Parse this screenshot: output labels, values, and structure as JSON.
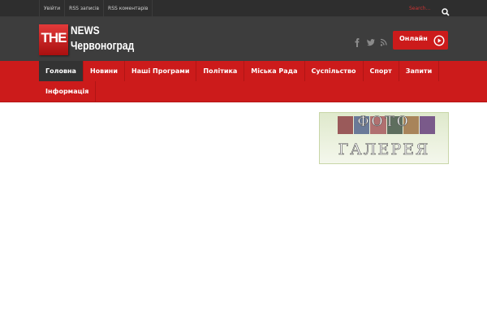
{
  "topbar": {
    "links": [
      "Увійти",
      "RSS записів",
      "RSS коментарів"
    ],
    "search_placeholder": "Search..."
  },
  "logo": {
    "the": "THE",
    "news": "NEWS",
    "city": "Червоноград"
  },
  "header": {
    "social_icons": [
      "facebook-icon",
      "twitter-icon",
      "rss-icon"
    ],
    "online_label": "Онлайн"
  },
  "nav": {
    "items": [
      {
        "label": "Головна",
        "active": true
      },
      {
        "label": "Новини",
        "active": false
      },
      {
        "label": "Наші Програми",
        "active": false
      },
      {
        "label": "Політика",
        "active": false
      },
      {
        "label": "Міська Рада",
        "active": false
      },
      {
        "label": "Суспільство",
        "active": false
      },
      {
        "label": "Спорт",
        "active": false
      },
      {
        "label": "Запити",
        "active": false
      },
      {
        "label": "Інформація",
        "active": false
      }
    ]
  },
  "sidebar": {
    "gallery_line1": "ФОТО",
    "gallery_line2": "ГАЛЕРЕЯ"
  },
  "colors": {
    "topbar_bg": "#2e2e2e",
    "header_bg": "#3d3d3d",
    "accent_red": "#cc1b1b",
    "nav_active_bg": "#333333"
  }
}
